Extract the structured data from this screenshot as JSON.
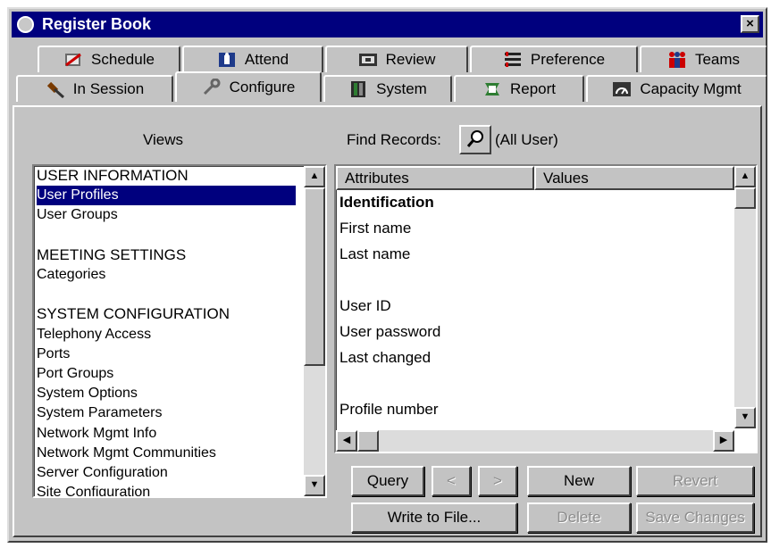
{
  "window": {
    "title": "Register Book",
    "close_label": "×"
  },
  "tabs_row1": [
    {
      "label": "Schedule",
      "icon": "schedule-icon"
    },
    {
      "label": "Attend",
      "icon": "attend-icon"
    },
    {
      "label": "Review",
      "icon": "review-icon"
    },
    {
      "label": "Preference",
      "icon": "preference-icon"
    },
    {
      "label": "Teams",
      "icon": "teams-icon"
    }
  ],
  "tabs_row2": [
    {
      "label": "In Session",
      "icon": "gavel-icon"
    },
    {
      "label": "Configure",
      "icon": "wrench-icon",
      "active": true
    },
    {
      "label": "System",
      "icon": "system-icon"
    },
    {
      "label": "Report",
      "icon": "report-icon"
    },
    {
      "label": "Capacity Mgmt",
      "icon": "gauge-icon"
    }
  ],
  "views": {
    "label": "Views",
    "items": [
      {
        "label": "USER INFORMATION",
        "type": "header"
      },
      {
        "label": "User Profiles",
        "selected": true
      },
      {
        "label": "User Groups"
      },
      {
        "label": "",
        "type": "spacer"
      },
      {
        "label": "MEETING SETTINGS",
        "type": "header"
      },
      {
        "label": "Categories"
      },
      {
        "label": "",
        "type": "spacer"
      },
      {
        "label": "SYSTEM CONFIGURATION",
        "type": "header"
      },
      {
        "label": "Telephony Access"
      },
      {
        "label": "Ports"
      },
      {
        "label": "Port Groups"
      },
      {
        "label": "System Options"
      },
      {
        "label": "System Parameters"
      },
      {
        "label": "Network Mgmt Info"
      },
      {
        "label": "Network Mgmt Communities"
      },
      {
        "label": "Server Configuration"
      },
      {
        "label": "Site Configuration"
      }
    ]
  },
  "find": {
    "label": "Find Records:",
    "scope": "(All User)"
  },
  "grid": {
    "columns": [
      "Attributes",
      "Values"
    ],
    "rows": [
      {
        "label": "Identification",
        "bold": true
      },
      {
        "label": "First name"
      },
      {
        "label": "Last name"
      },
      {
        "label": ""
      },
      {
        "label": "User ID"
      },
      {
        "label": "User password"
      },
      {
        "label": "Last changed"
      },
      {
        "label": ""
      },
      {
        "label": "Profile number"
      }
    ]
  },
  "buttons": {
    "query": "Query",
    "prev": "<",
    "next": ">",
    "new": "New",
    "revert": "Revert",
    "write": "Write to File...",
    "delete": "Delete",
    "save": "Save Changes"
  },
  "colors": {
    "titlebar": "#00007e",
    "face": "#c3c3c3",
    "selection": "#00007e"
  }
}
